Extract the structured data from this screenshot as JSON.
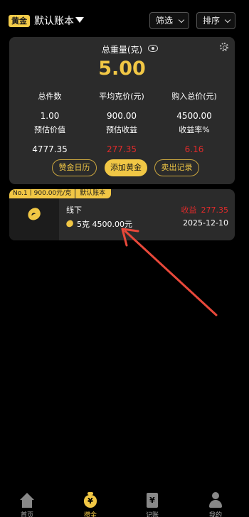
{
  "header": {
    "tag": "黄金",
    "account_name": "默认账本",
    "filter_label": "筛选",
    "sort_label": "排序"
  },
  "summary": {
    "title": "总重量(克)",
    "total_weight": "5.00",
    "stats": [
      {
        "label": "总件数",
        "value": "1.00"
      },
      {
        "label": "平均克价(元)",
        "value": "900.00"
      },
      {
        "label": "购入总价(元)",
        "value": "4500.00"
      },
      {
        "label": "预估价值",
        "value": "4777.35"
      },
      {
        "label": "预估收益",
        "value": "277.35"
      },
      {
        "label": "收益率%",
        "value": "6.16"
      }
    ],
    "buttons": {
      "calendar": "赞金日历",
      "add": "添加黄金",
      "sell_records": "卖出记录"
    }
  },
  "item": {
    "badge_no": "No.1丨900.00元/克",
    "badge_account": "默认账本",
    "name": "线下",
    "profit_label": "收益",
    "profit_value": "277.35",
    "weight_price": "5克 4500.00元",
    "date": "2025-12-10"
  },
  "nav": {
    "items": [
      {
        "label": "首页",
        "icon": "home-icon"
      },
      {
        "label": "攒金",
        "icon": "gold-bag-icon"
      },
      {
        "label": "记账",
        "icon": "ledger-icon"
      },
      {
        "label": "我的",
        "icon": "user-icon"
      }
    ],
    "active": 1
  },
  "colors": {
    "gold": "#f1c745",
    "red": "#e02b2b",
    "card": "#2b2b2b",
    "background": "#000000",
    "annotation_arrow": "#e8483a"
  }
}
